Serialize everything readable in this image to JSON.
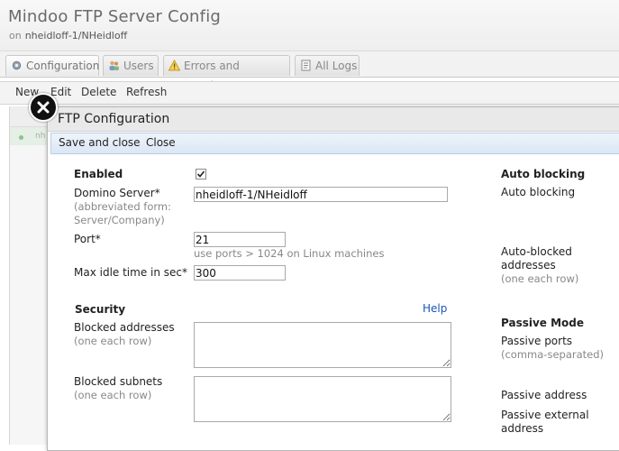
{
  "app": {
    "title": "Mindoo FTP Server Config",
    "on_prefix": "on",
    "server": "nheidloff-1/NHeidloff"
  },
  "tabs": [
    {
      "label": "Configuration",
      "icon": "gear-icon"
    },
    {
      "label": "Users",
      "icon": "users-icon"
    },
    {
      "label": "Errors and warnings",
      "icon": "warning-icon"
    },
    {
      "label": "All Logs",
      "icon": "log-icon"
    }
  ],
  "toolbar": {
    "new": "New",
    "edit": "Edit",
    "delete": "Delete",
    "refresh": "Refresh"
  },
  "background_grid": {
    "row_text": "nh"
  },
  "dialog": {
    "title": "FTP Configuration",
    "save_close": "Save and close",
    "close": "Close",
    "enabled": {
      "label": "Enabled",
      "checked": true
    },
    "domino_server": {
      "label": "Domino Server*",
      "hint": "(abbreviated form: Server/Company)",
      "value": "nheidloff-1/NHeidloff"
    },
    "port": {
      "label": "Port*",
      "value": "21",
      "hint": "use ports > 1024 on Linux machines"
    },
    "max_idle": {
      "label": "Max idle time in sec*",
      "value": "300"
    },
    "security": {
      "heading": "Security",
      "help": "Help"
    },
    "blocked_addresses": {
      "label": "Blocked addresses",
      "hint": "(one each row)",
      "value": ""
    },
    "blocked_subnets": {
      "label": "Blocked subnets",
      "hint": "(one each row)",
      "value": ""
    },
    "right": {
      "auto_blocking_heading": "Auto blocking",
      "auto_blocking_label": "Auto blocking",
      "auto_blocked_label": "Auto-blocked addresses",
      "auto_blocked_hint": "(one each row)",
      "passive_heading": "Passive Mode",
      "passive_ports_label": "Passive ports",
      "passive_ports_hint": "(comma-separated)",
      "passive_address_label": "Passive address",
      "passive_external_label": "Passive external address"
    }
  }
}
